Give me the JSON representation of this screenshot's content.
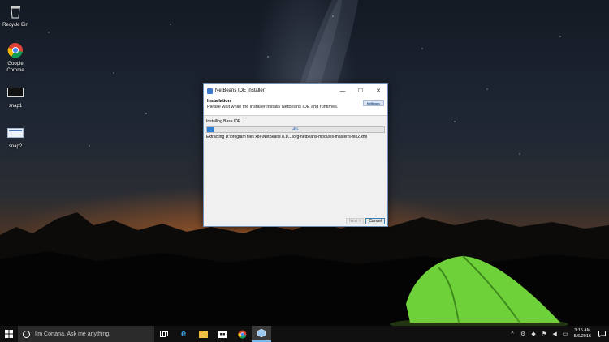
{
  "desktop": {
    "icons": [
      {
        "label": "Recycle Bin",
        "icon": "recycle-bin-icon"
      },
      {
        "label": "Google\nChrome",
        "icon": "chrome-icon"
      },
      {
        "label": "snap1",
        "icon": "snap-image-icon"
      },
      {
        "label": "snap2",
        "icon": "snap-image-icon"
      }
    ]
  },
  "installer": {
    "title": "NetBeans IDE Installer",
    "header_title": "Installation",
    "header_subtitle": "Please wait while the installer installs NetBeans IDE and runtimes.",
    "logo_text": "NetBeans",
    "status": "Installing Base IDE...",
    "progress_percent": 4,
    "progress_label": "4%",
    "detail": "Extracting D:\\program files x86\\NetBeans 8.1\\...\\org-netbeans-modules-masterfs-nio2.xml",
    "buttons": {
      "next": "Next >",
      "cancel": "Cancel"
    }
  },
  "taskbar": {
    "search_placeholder": "I'm Cortana. Ask me anything.",
    "clock_time": "3:15 AM",
    "clock_date": "5/6/2016",
    "colors": {
      "accent": "#76b9ed",
      "background": "#101010"
    }
  }
}
